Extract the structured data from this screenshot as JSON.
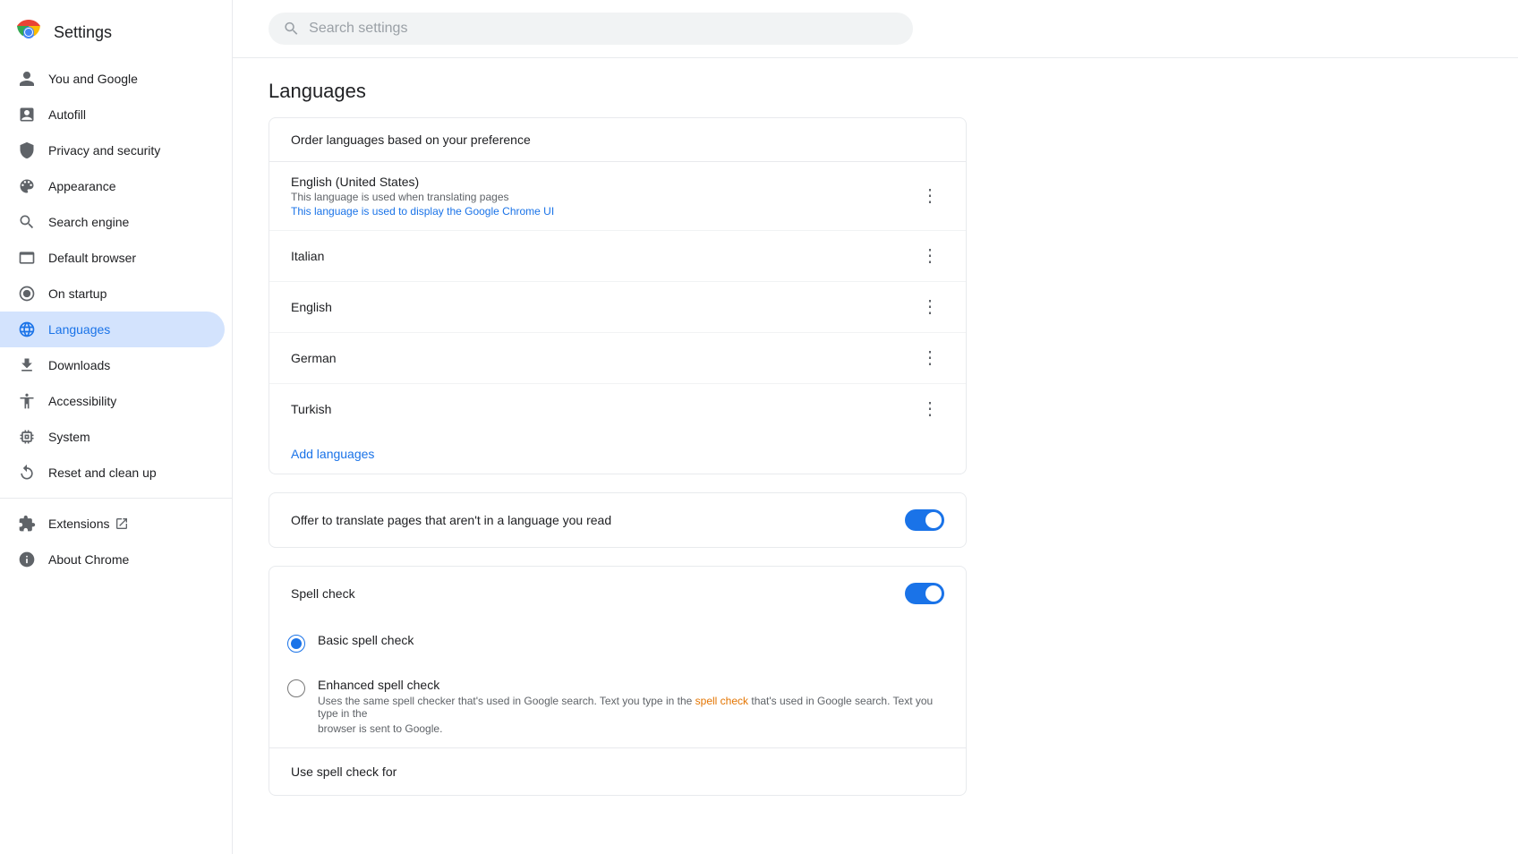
{
  "sidebar": {
    "title": "Settings",
    "items": [
      {
        "id": "you-google",
        "label": "You and Google",
        "icon": "person"
      },
      {
        "id": "autofill",
        "label": "Autofill",
        "icon": "autofill"
      },
      {
        "id": "privacy-security",
        "label": "Privacy and security",
        "icon": "shield"
      },
      {
        "id": "appearance",
        "label": "Appearance",
        "icon": "appearance"
      },
      {
        "id": "search-engine",
        "label": "Search engine",
        "icon": "search"
      },
      {
        "id": "default-browser",
        "label": "Default browser",
        "icon": "browser"
      },
      {
        "id": "on-startup",
        "label": "On startup",
        "icon": "startup"
      },
      {
        "id": "languages",
        "label": "Languages",
        "icon": "globe",
        "active": true
      },
      {
        "id": "downloads",
        "label": "Downloads",
        "icon": "download"
      },
      {
        "id": "accessibility",
        "label": "Accessibility",
        "icon": "accessibility"
      },
      {
        "id": "system",
        "label": "System",
        "icon": "system"
      },
      {
        "id": "reset-clean-up",
        "label": "Reset and clean up",
        "icon": "reset"
      },
      {
        "id": "extensions",
        "label": "Extensions",
        "icon": "extensions",
        "hasLink": true
      },
      {
        "id": "about-chrome",
        "label": "About Chrome",
        "icon": "info"
      }
    ]
  },
  "search": {
    "placeholder": "Search settings"
  },
  "main": {
    "page_title": "Languages",
    "languages_card": {
      "header": "Order languages based on your preference",
      "items": [
        {
          "name": "English (United States)",
          "sub1": "This language is used when translating pages",
          "sub2": "This language is used to display the Google Chrome UI",
          "sub2_is_link": true
        },
        {
          "name": "Italian",
          "sub1": "",
          "sub2": ""
        },
        {
          "name": "English",
          "sub1": "",
          "sub2": ""
        },
        {
          "name": "German",
          "sub1": "",
          "sub2": ""
        },
        {
          "name": "Turkish",
          "sub1": "",
          "sub2": ""
        }
      ],
      "add_languages_label": "Add languages"
    },
    "translate_row": {
      "label": "Offer to translate pages that aren't in a language you read",
      "toggle_on": true
    },
    "spell_check": {
      "title": "Spell check",
      "toggle_on": true,
      "basic_label": "Basic spell check",
      "enhanced_label": "Enhanced spell check",
      "enhanced_sub1": "Uses the same spell checker that's used in Google search. Text you type in the",
      "enhanced_sub2": "browser is sent to Google.",
      "enhanced_sub_highlight": "spell check",
      "basic_selected": true
    },
    "use_spell_check_for": "Use spell check for"
  }
}
